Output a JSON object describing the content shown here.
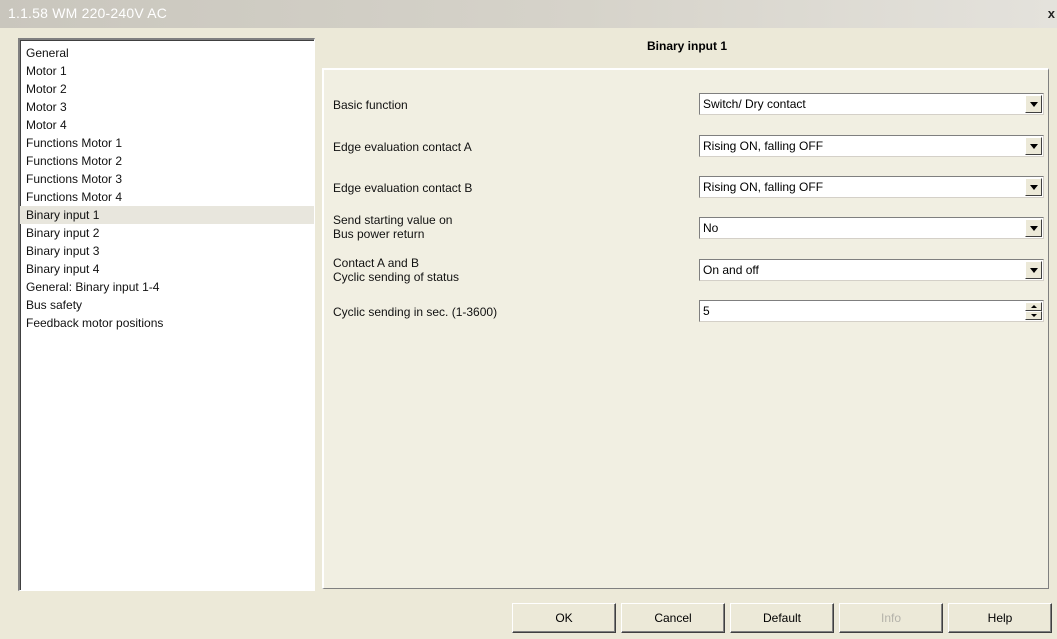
{
  "window": {
    "title": "1.1.58 WM 220-240V AC",
    "close_glyph": "x"
  },
  "tree": {
    "items": [
      {
        "label": "General"
      },
      {
        "label": "Motor 1"
      },
      {
        "label": "Motor 2"
      },
      {
        "label": "Motor 3"
      },
      {
        "label": "Motor 4"
      },
      {
        "label": "Functions Motor 1"
      },
      {
        "label": "Functions Motor 2"
      },
      {
        "label": "Functions Motor 3"
      },
      {
        "label": "Functions Motor 4"
      },
      {
        "label": "Binary input 1",
        "selected": true
      },
      {
        "label": "Binary input 2"
      },
      {
        "label": "Binary input 3"
      },
      {
        "label": "Binary input 4"
      },
      {
        "label": "General: Binary input 1-4"
      },
      {
        "label": "Bus safety"
      },
      {
        "label": "Feedback motor positions"
      }
    ]
  },
  "page": {
    "header": "Binary input 1"
  },
  "params": {
    "basic_function": {
      "label": "Basic function",
      "value": "Switch/ Dry contact"
    },
    "edge_a": {
      "label": "Edge evaluation contact A",
      "value": "Rising ON, falling OFF"
    },
    "edge_b": {
      "label": "Edge evaluation contact B",
      "value": "Rising ON, falling OFF"
    },
    "send_start": {
      "label_line1": "Send starting value on",
      "label_line2": "Bus power return",
      "value": "No"
    },
    "cyclic_status": {
      "label_line1": "Contact A and B",
      "label_line2": "Cyclic sending of status",
      "value": "On and off"
    },
    "cyclic_seconds": {
      "label": "Cyclic sending in sec. (1-3600)",
      "value": "5"
    }
  },
  "buttons": {
    "ok": "OK",
    "cancel": "Cancel",
    "default": "Default",
    "info": "Info",
    "help": "Help"
  },
  "icons": {
    "dropdown": "chevron-down-icon",
    "spinner_up": "spin-up-icon",
    "spinner_down": "spin-down-icon"
  }
}
